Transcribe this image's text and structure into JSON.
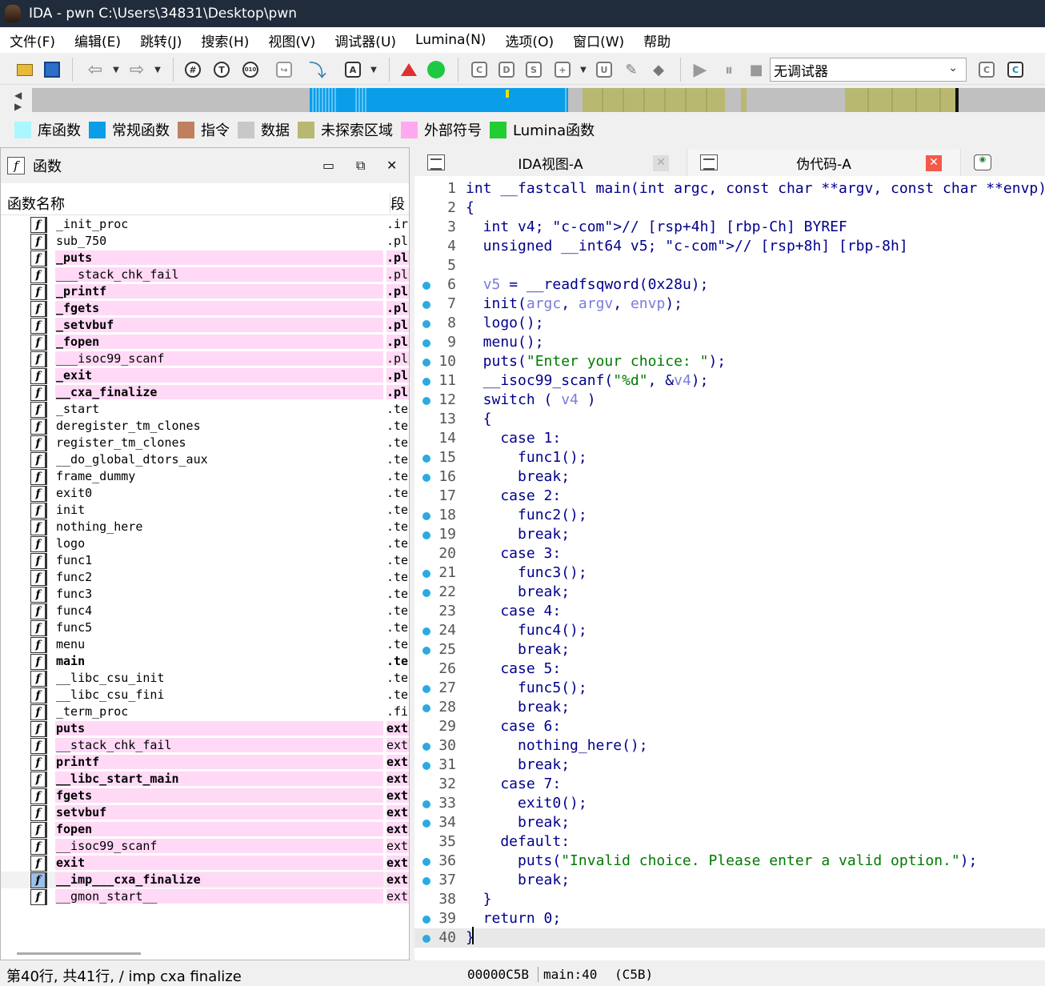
{
  "window": {
    "title": "IDA - pwn C:\\Users\\34831\\Desktop\\pwn"
  },
  "menu": [
    "文件(F)",
    "编辑(E)",
    "跳转(J)",
    "搜索(H)",
    "视图(V)",
    "调试器(U)",
    "Lumina(N)",
    "选项(O)",
    "窗口(W)",
    "帮助"
  ],
  "toolbar": {
    "debugger_select": "无调试器"
  },
  "legend": [
    {
      "label": "库函数",
      "color": "#aaf7ff"
    },
    {
      "label": "常规函数",
      "color": "#0a9de8"
    },
    {
      "label": "指令",
      "color": "#c08060"
    },
    {
      "label": "数据",
      "color": "#c8c8c8"
    },
    {
      "label": "未探索区域",
      "color": "#b8b870"
    },
    {
      "label": "外部符号",
      "color": "#ffa8f0"
    },
    {
      "label": "Lumina函数",
      "color": "#22cc33"
    }
  ],
  "functions_pane": {
    "title": "函数",
    "col_name": "函数名称",
    "col_segment": "段",
    "rows": [
      {
        "name": "_init_proc",
        "seg": ".ir"
      },
      {
        "name": "sub_750",
        "seg": ".pl"
      },
      {
        "name": "_puts",
        "seg": ".pl"
      },
      {
        "name": "___stack_chk_fail",
        "seg": ".pl"
      },
      {
        "name": "_printf",
        "seg": ".pl"
      },
      {
        "name": "_fgets",
        "seg": ".pl"
      },
      {
        "name": "_setvbuf",
        "seg": ".pl"
      },
      {
        "name": "_fopen",
        "seg": ".pl"
      },
      {
        "name": "___isoc99_scanf",
        "seg": ".pl"
      },
      {
        "name": "_exit",
        "seg": ".pl"
      },
      {
        "name": "__cxa_finalize",
        "seg": ".pl"
      },
      {
        "name": "_start",
        "seg": ".te"
      },
      {
        "name": "deregister_tm_clones",
        "seg": ".te"
      },
      {
        "name": "register_tm_clones",
        "seg": ".te"
      },
      {
        "name": "__do_global_dtors_aux",
        "seg": ".te"
      },
      {
        "name": "frame_dummy",
        "seg": ".te"
      },
      {
        "name": "exit0",
        "seg": ".te"
      },
      {
        "name": "init",
        "seg": ".te"
      },
      {
        "name": "nothing_here",
        "seg": ".te"
      },
      {
        "name": "logo",
        "seg": ".te"
      },
      {
        "name": "func1",
        "seg": ".te"
      },
      {
        "name": "func2",
        "seg": ".te"
      },
      {
        "name": "func3",
        "seg": ".te"
      },
      {
        "name": "func4",
        "seg": ".te"
      },
      {
        "name": "func5",
        "seg": ".te"
      },
      {
        "name": "menu",
        "seg": ".te"
      },
      {
        "name": "main",
        "seg": ".te"
      },
      {
        "name": "__libc_csu_init",
        "seg": ".te"
      },
      {
        "name": "__libc_csu_fini",
        "seg": ".te"
      },
      {
        "name": "_term_proc",
        "seg": ".fi"
      },
      {
        "name": "puts",
        "seg": "ext"
      },
      {
        "name": "__stack_chk_fail",
        "seg": "ext"
      },
      {
        "name": "printf",
        "seg": "ext"
      },
      {
        "name": "__libc_start_main",
        "seg": "ext"
      },
      {
        "name": "fgets",
        "seg": "ext"
      },
      {
        "name": "setvbuf",
        "seg": "ext"
      },
      {
        "name": "fopen",
        "seg": "ext"
      },
      {
        "name": "__isoc99_scanf",
        "seg": "ext"
      },
      {
        "name": "exit",
        "seg": "ext"
      },
      {
        "name": "__imp___cxa_finalize",
        "seg": "ext"
      },
      {
        "name": "__gmon_start__",
        "seg": "ext"
      }
    ]
  },
  "status": {
    "left": "第40行, 共41行, /   imp    cxa  finalize",
    "address": "00000C5B",
    "location": "main:40",
    "offset": "(C5B)"
  },
  "tabs": {
    "ida_view": "IDA视图-A",
    "pseudocode": "伪代码-A"
  },
  "pseudocode": [
    "int __fastcall main(int argc, const char **argv, const char **envp)",
    "{",
    "  int v4; // [rsp+4h] [rbp-Ch] BYREF",
    "  unsigned __int64 v5; // [rsp+8h] [rbp-8h]",
    "",
    "  v5 = __readfsqword(0x28u);",
    "  init(argc, argv, envp);",
    "  logo();",
    "  menu();",
    "  puts(\"Enter your choice: \");",
    "  __isoc99_scanf(\"%d\", &v4);",
    "  switch ( v4 )",
    "  {",
    "    case 1:",
    "      func1();",
    "      break;",
    "    case 2:",
    "      func2();",
    "      break;",
    "    case 3:",
    "      func3();",
    "      break;",
    "    case 4:",
    "      func4();",
    "      break;",
    "    case 5:",
    "      func5();",
    "      break;",
    "    case 6:",
    "      nothing_here();",
    "      break;",
    "    case 7:",
    "      exit0();",
    "      break;",
    "    default:",
    "      puts(\"Invalid choice. Please enter a valid option.\");",
    "      break;",
    "  }",
    "  return 0;",
    "}"
  ]
}
